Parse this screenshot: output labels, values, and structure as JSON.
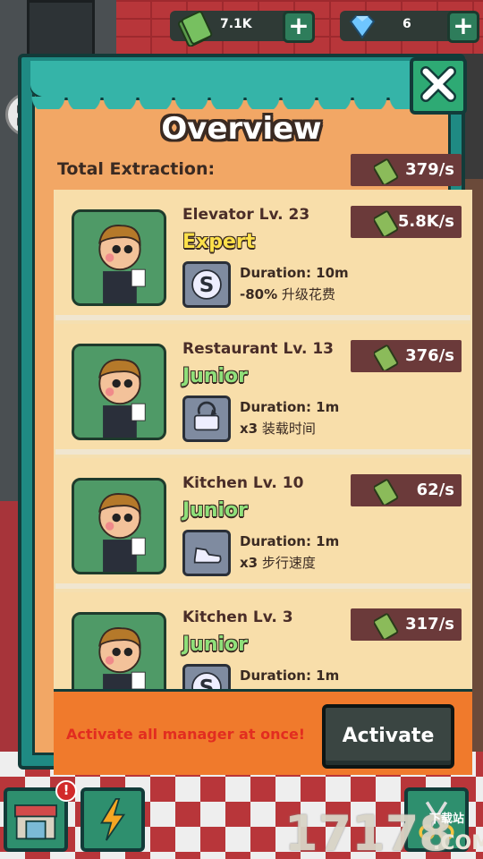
{
  "hud": {
    "cash_value": "7.1K",
    "gem_value": "6",
    "cash_icon": "cash-stack-icon",
    "gem_icon": "diamond-icon",
    "plus_icon": "plus-icon"
  },
  "modal": {
    "title": "Overview",
    "total_label": "Total Extraction:",
    "total_rate": "379/s",
    "close_icon": "close-x-icon"
  },
  "managers": [
    {
      "name": "Elevator Lv. 23",
      "rank": "Expert",
      "rate": "5.8K/s",
      "duration": "Duration: 10m",
      "effect_value": "-80%",
      "effect_text": "升级花费",
      "skill_icon": "s-skill-icon"
    },
    {
      "name": "Restaurant Lv. 13",
      "rank": "Junior",
      "rate": "376/s",
      "duration": "Duration: 1m",
      "effect_value": "x3",
      "effect_text": "装载时间",
      "skill_icon": "loading-skill-icon"
    },
    {
      "name": "Kitchen Lv. 10",
      "rank": "Junior",
      "rate": "62/s",
      "duration": "Duration: 1m",
      "effect_value": "x3",
      "effect_text": "步行速度",
      "skill_icon": "shoe-skill-icon"
    },
    {
      "name": "Kitchen Lv. 3",
      "rank": "Junior",
      "rate": "317/s",
      "duration": "Duration: 1m",
      "effect_value": "",
      "effect_text": "",
      "skill_icon": "s-skill-icon"
    }
  ],
  "footer": {
    "hint": "Activate all manager at once!",
    "activate_label": "Activate"
  },
  "nav": {
    "alert_badge": "!",
    "shop_icon": "shop-icon",
    "boost_icon": "lightning-icon",
    "tools_icon": "scissors-icon"
  },
  "watermark": {
    "brand": "17178",
    "sub": "下载站",
    "domain": ".COM"
  },
  "colors": {
    "expert": "#ffe14a",
    "junior": "#8fe07a",
    "rate_badge": "#6b3a3a",
    "hint_text": "#e22d20"
  }
}
